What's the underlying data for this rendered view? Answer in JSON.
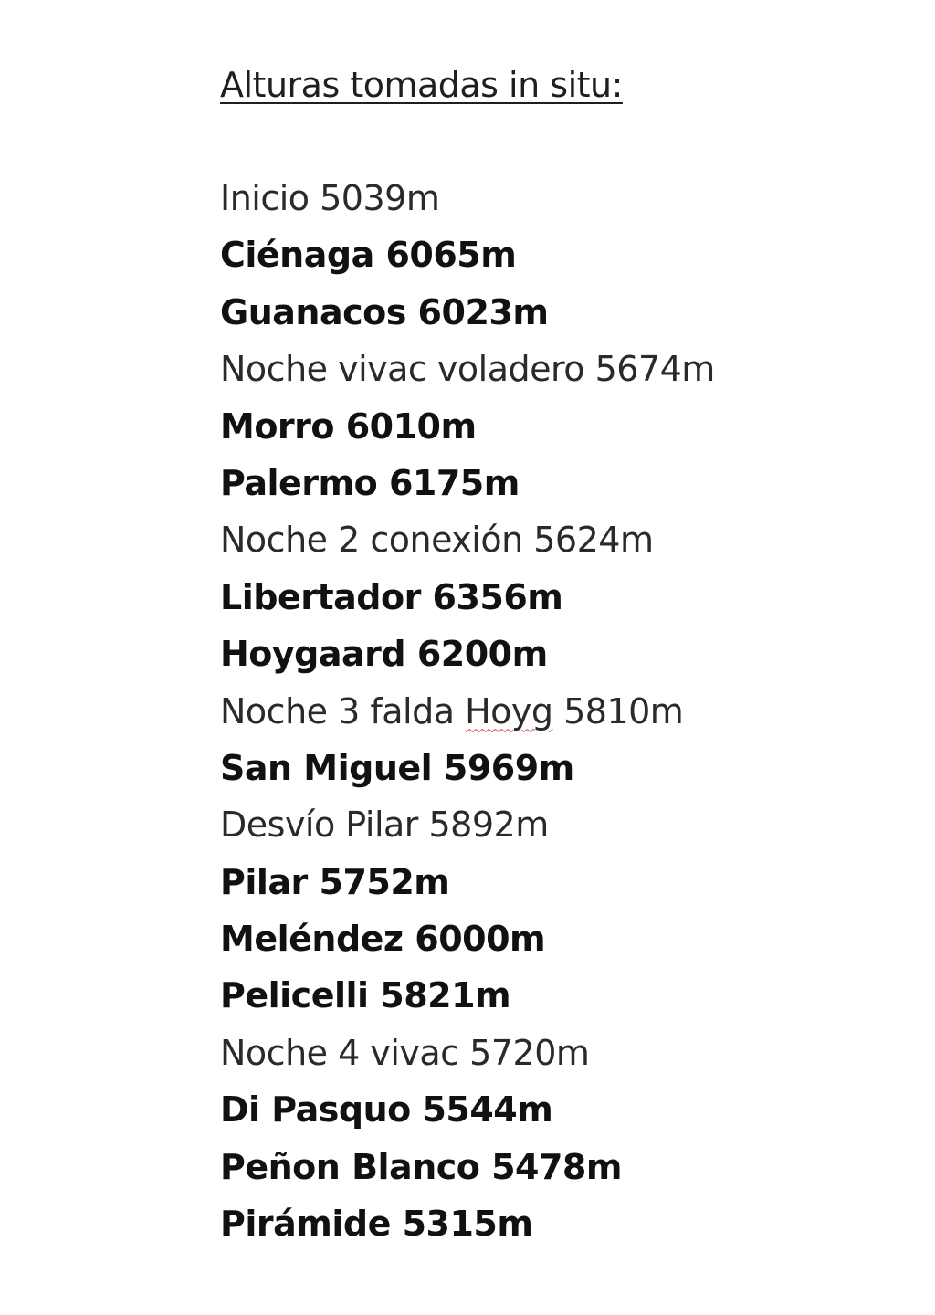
{
  "document": {
    "title": "Alturas tomadas in situ:",
    "entries": [
      {
        "text": "Inicio 5039m",
        "bold": false
      },
      {
        "text": "Ciénaga 6065m",
        "bold": true
      },
      {
        "text": "Guanacos 6023m",
        "bold": true
      },
      {
        "text": "Noche vivac voladero 5674m",
        "bold": false
      },
      {
        "text": "Morro 6010m",
        "bold": true
      },
      {
        "text": "Palermo 6175m",
        "bold": true
      },
      {
        "text": "Noche 2 conexión 5624m",
        "bold": false
      },
      {
        "text": "Libertador 6356m",
        "bold": true
      },
      {
        "text": "Hoygaard 6200m",
        "bold": true
      },
      {
        "text_before": "Noche 3 falda ",
        "misspelled": "Hoyg",
        "text_after": " 5810m",
        "bold": false
      },
      {
        "text": "San Miguel 5969m",
        "bold": true
      },
      {
        "text": "Desvío Pilar 5892m",
        "bold": false
      },
      {
        "text": "Pilar 5752m",
        "bold": true
      },
      {
        "text": "Meléndez 6000m",
        "bold": true
      },
      {
        "text": "Pelicelli 5821m",
        "bold": true
      },
      {
        "text": "Noche 4 vivac 5720m",
        "bold": false
      },
      {
        "text": "Di Pasquo 5544m",
        "bold": true
      },
      {
        "text": "Peñon Blanco 5478m",
        "bold": true
      },
      {
        "text": "Pirámide 5315m",
        "bold": true
      }
    ]
  }
}
